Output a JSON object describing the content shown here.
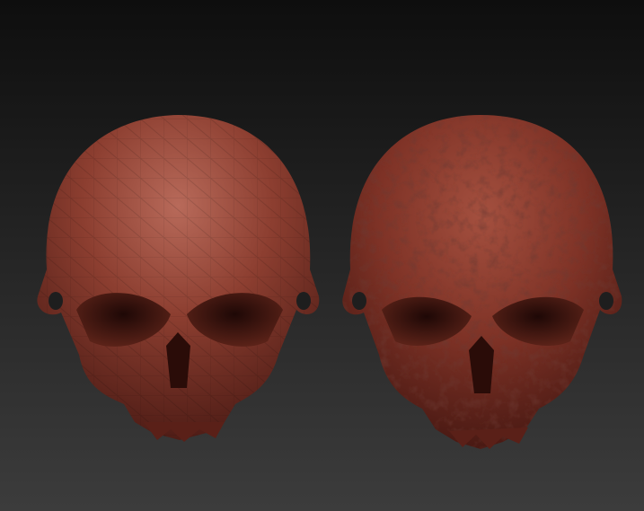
{
  "colors": {
    "background_top": "#0e0e0e",
    "background_bottom": "#3c3c3c",
    "skull_highlight": "#b86a5a",
    "skull_mid": "#8c3e30",
    "skull_shadow": "#4a1a14",
    "socket": "#1e0806"
  }
}
